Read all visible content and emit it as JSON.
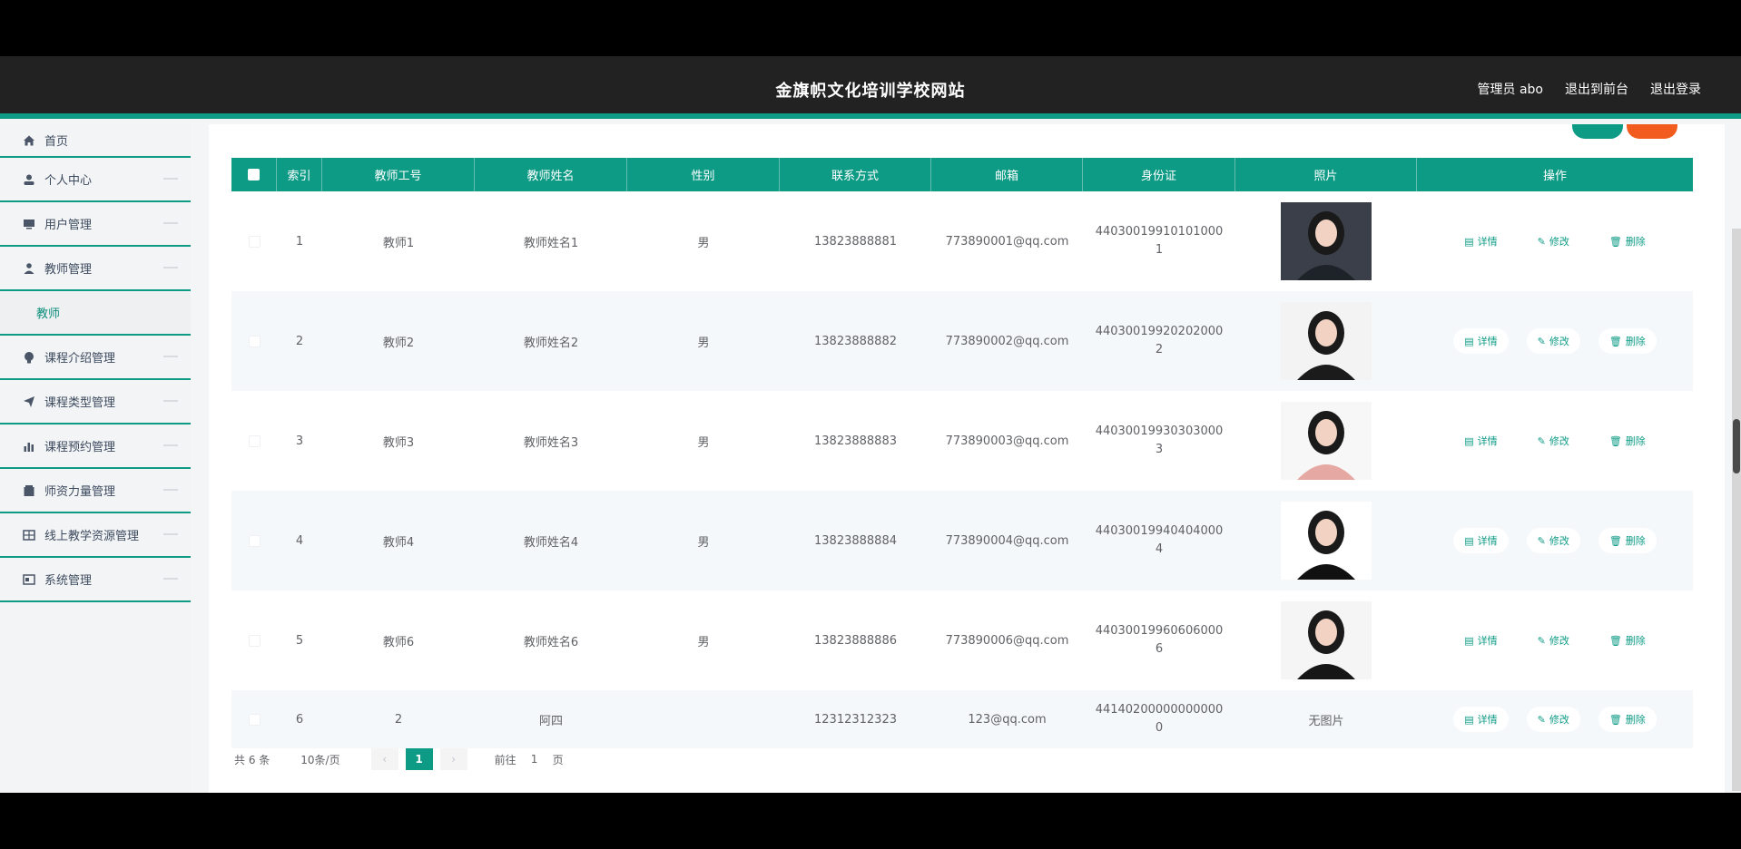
{
  "header": {
    "site_title": "金旗帜文化培训学校网站",
    "admin": "管理员 abo",
    "to_front": "退出到前台",
    "logout": "退出登录"
  },
  "sidebar": {
    "items": [
      {
        "label": "首页",
        "icon": "home-icon"
      },
      {
        "label": "个人中心",
        "icon": "user-icon"
      },
      {
        "label": "用户管理",
        "icon": "monitor-icon"
      },
      {
        "label": "教师管理",
        "icon": "person-icon"
      },
      {
        "label": "课程介绍管理",
        "icon": "badge-icon"
      },
      {
        "label": "课程类型管理",
        "icon": "send-icon"
      },
      {
        "label": "课程预约管理",
        "icon": "bar-chart-icon"
      },
      {
        "label": "师资力量管理",
        "icon": "bank-icon"
      },
      {
        "label": "线上教学资源管理",
        "icon": "grid-icon"
      },
      {
        "label": "系统管理",
        "icon": "window-icon"
      }
    ],
    "submenu_teacher": "教师"
  },
  "table": {
    "headers": [
      "索引",
      "教师工号",
      "教师姓名",
      "性别",
      "联系方式",
      "邮箱",
      "身份证",
      "照片",
      "操作"
    ],
    "rows": [
      {
        "idx": "1",
        "no": "教师1",
        "name": "教师姓名1",
        "sex": "男",
        "tel": "13823888881",
        "mail": "773890001@qq.com",
        "id": "440300199101010001",
        "photo": "photo"
      },
      {
        "idx": "2",
        "no": "教师2",
        "name": "教师姓名2",
        "sex": "男",
        "tel": "13823888882",
        "mail": "773890002@qq.com",
        "id": "440300199202020002",
        "photo": "photo"
      },
      {
        "idx": "3",
        "no": "教师3",
        "name": "教师姓名3",
        "sex": "男",
        "tel": "13823888883",
        "mail": "773890003@qq.com",
        "id": "440300199303030003",
        "photo": "photo"
      },
      {
        "idx": "4",
        "no": "教师4",
        "name": "教师姓名4",
        "sex": "男",
        "tel": "13823888884",
        "mail": "773890004@qq.com",
        "id": "440300199404040004",
        "photo": "photo"
      },
      {
        "idx": "5",
        "no": "教师6",
        "name": "教师姓名6",
        "sex": "男",
        "tel": "13823888886",
        "mail": "773890006@qq.com",
        "id": "440300199606060006",
        "photo": "photo"
      },
      {
        "idx": "6",
        "no": "2",
        "name": "阿四",
        "sex": "",
        "tel": "12312312323",
        "mail": "123@qq.com",
        "id": "441402000000000000",
        "photo": "无图片"
      }
    ],
    "ops": {
      "detail": "详情",
      "edit": "修改",
      "delete": "删除"
    }
  },
  "pager": {
    "total": "共 6 条",
    "size": "10条/页",
    "page": "1",
    "goto": "前往",
    "goto_value": "1",
    "page_unit": "页"
  },
  "colors": {
    "accent": "#0e9b86",
    "danger": "#f25c1f",
    "topbar": "#222222"
  }
}
